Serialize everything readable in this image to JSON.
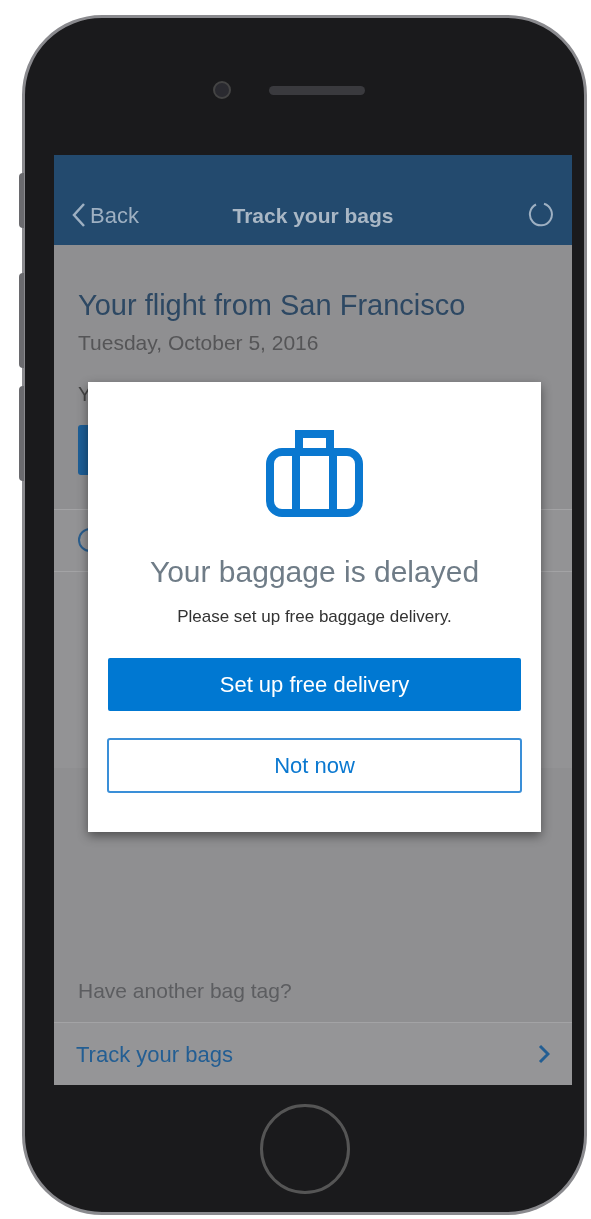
{
  "header": {
    "back_label": "Back",
    "title": "Track your bags"
  },
  "flight": {
    "title": "Your flight from San Francisco",
    "date": "Tuesday, October 5, 2016",
    "line_1": "Y"
  },
  "another_tag": {
    "prompt": "Have another bag tag?",
    "link": "Track your bags"
  },
  "dialog": {
    "heading": "Your baggage is delayed",
    "message": "Please set up free baggage delivery.",
    "primary_button": "Set up free delivery",
    "secondary_button": "Not now"
  }
}
